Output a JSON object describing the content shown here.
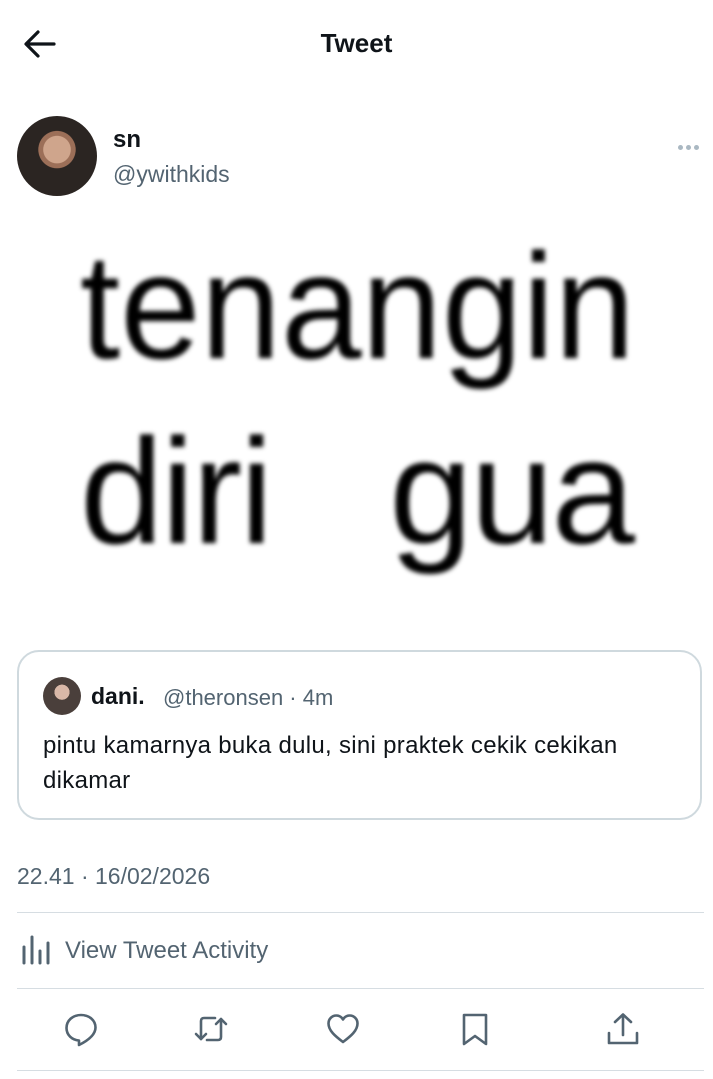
{
  "header": {
    "title": "Tweet",
    "back_icon": "arrow-left-icon"
  },
  "author": {
    "display_name": "sn",
    "handle": "@ywithkids"
  },
  "tweet": {
    "media_text": "tenangin diri gua"
  },
  "quoted": {
    "display_name": "dani.",
    "handle_time": "@theronsen · 4m",
    "text": "pintu kamarnya buka dulu, sini praktek cekik cekikan dikamar"
  },
  "meta": {
    "timestamp": "22.41 · 16/02/2026"
  },
  "activity": {
    "label": "View Tweet Activity",
    "icon": "bar-chart-icon"
  },
  "actions": [
    "reply-icon",
    "retweet-icon",
    "like-icon",
    "bookmark-icon",
    "share-icon"
  ],
  "colors": {
    "text": "#0f1419",
    "secondary": "#536471",
    "border": "#cfd9de"
  }
}
